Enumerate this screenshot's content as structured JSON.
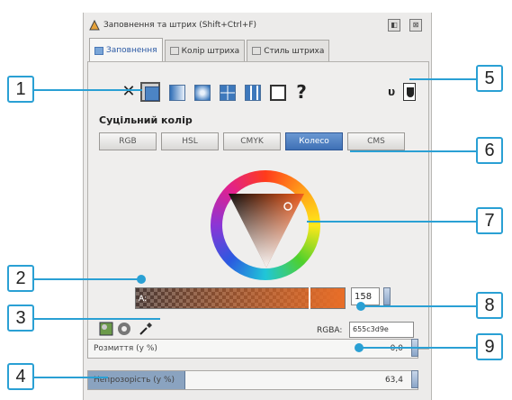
{
  "window": {
    "title": "Заповнення та штрих (Shift+Ctrl+F)",
    "btn_dock": "◧",
    "btn_close": "⊠"
  },
  "tabs": [
    {
      "label": "Заповнення",
      "icon": "fill-tab-icon"
    },
    {
      "label": "Колір штриха",
      "icon": "stroke-paint-tab-icon"
    },
    {
      "label": "Стиль штриха",
      "icon": "stroke-style-tab-icon"
    }
  ],
  "fill_types": {
    "none": "✕",
    "unset": "?",
    "even_odd": "υ"
  },
  "flat_color_label": "Суцільний колір",
  "color_modes": [
    "RGB",
    "HSL",
    "CMYK",
    "Колесо",
    "CMS"
  ],
  "active_mode": "Колесо",
  "alpha": {
    "label": "А:",
    "value": "158"
  },
  "rgba": {
    "label": "RGBA:",
    "value": "655c3d9e"
  },
  "blur": {
    "label": "Розмиття (у %)",
    "value": "0,0"
  },
  "opacity": {
    "label": "Непрозорість (у %)",
    "value": "63,4",
    "fraction": 0.634
  },
  "callouts": [
    "1",
    "2",
    "3",
    "4",
    "5",
    "6",
    "7",
    "8",
    "9"
  ],
  "colors": {
    "accent": "#2aa0d4",
    "active_mode": "#4a7bc0",
    "selected_color": "#655c3d"
  }
}
